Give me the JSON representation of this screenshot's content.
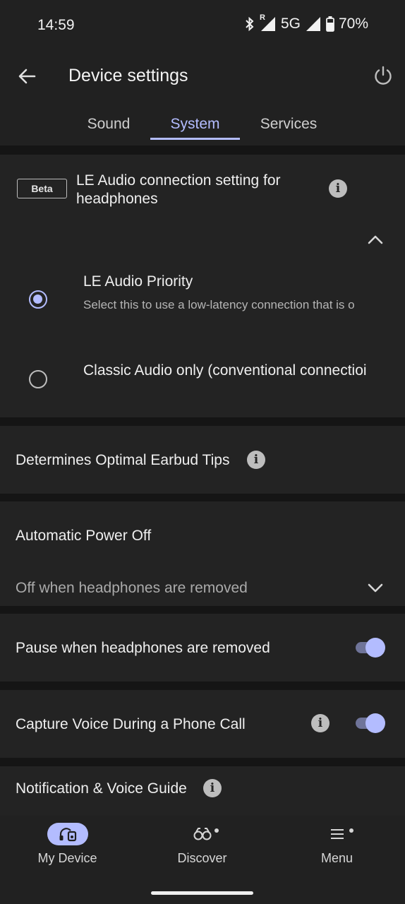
{
  "status_bar": {
    "time": "14:59",
    "network": "5G",
    "battery": "70%",
    "roaming_mark": "R"
  },
  "header": {
    "title": "Device settings"
  },
  "tabs": [
    {
      "label": "Sound",
      "active": false
    },
    {
      "label": "System",
      "active": true
    },
    {
      "label": "Services",
      "active": false
    }
  ],
  "le_audio": {
    "badge": "Beta",
    "title": "LE Audio connection setting for headphones",
    "options": [
      {
        "title": "LE Audio Priority",
        "subtitle": "Select this to use a low-latency connection that is o",
        "selected": true
      },
      {
        "title": "Classic Audio only (conventional connectioi",
        "subtitle": "",
        "selected": false
      }
    ]
  },
  "earbud_tips": {
    "label": "Determines Optimal Earbud Tips"
  },
  "auto_power_off": {
    "label": "Automatic Power Off",
    "value": "Off when headphones are removed"
  },
  "pause_removed": {
    "label": "Pause when headphones are removed",
    "on": true
  },
  "capture_voice": {
    "label": "Capture Voice During a Phone Call",
    "on": true
  },
  "notification_guide": {
    "label": "Notification & Voice Guide"
  },
  "bottom_nav": [
    {
      "label": "My Device",
      "icon": "headphones-device-icon",
      "active": true
    },
    {
      "label": "Discover",
      "icon": "binoculars-icon",
      "active": false,
      "dot": true
    },
    {
      "label": "Menu",
      "icon": "hamburger-menu-icon",
      "active": false,
      "dot": true
    }
  ],
  "colors": {
    "accent": "#b3bcff",
    "background": "#151515",
    "card": "#232323"
  }
}
